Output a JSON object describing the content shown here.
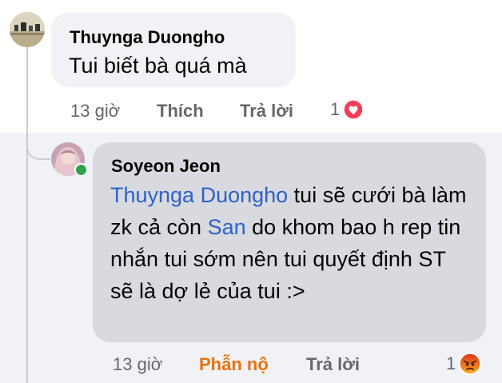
{
  "comment": {
    "author": "Thuynga Duongho",
    "text": "Tui biết bà quá mà",
    "time": "13 giờ",
    "like_label": "Thích",
    "reply_label": "Trả lời",
    "reaction_count": "1",
    "reaction_icon": "heart-icon",
    "reaction_color": "#f33e58"
  },
  "reply": {
    "author": "Soyeon Jeon",
    "mention1": "Thuynga Duongho",
    "text_part1": " tui sẽ cưới bà làm zk cả còn ",
    "mention2": "San",
    "text_part2": " do khom bao h rep tin nhắn tui sớm nên tui quyết định ST sẽ là dợ lẻ của tui :>",
    "time": "13 giờ",
    "reaction_label": "Phẫn nộ",
    "reply_label": "Trả lời",
    "reaction_count": "1",
    "reaction_icon": "angry-face-icon",
    "reaction_label_color": "#e9710f",
    "mention_color": "#2d62c9",
    "online_status_color": "#31a24c"
  }
}
